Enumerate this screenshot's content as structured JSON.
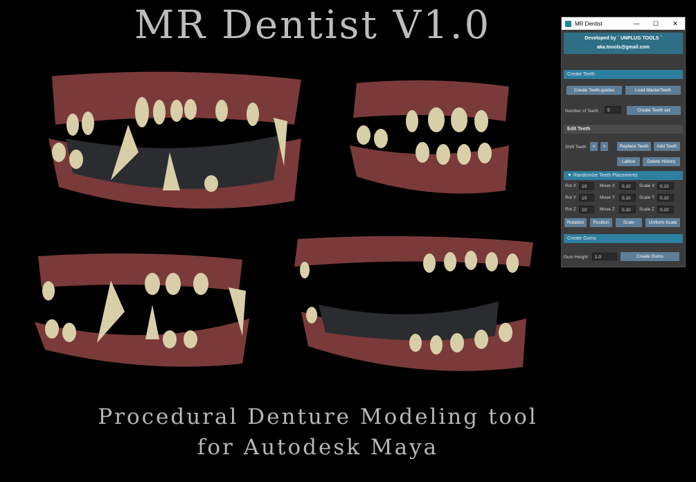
{
  "poster": {
    "title": "MR Dentist V1.0",
    "subtitle_line1": "Procedural Denture Modeling tool",
    "subtitle_line2": "for Autodesk Maya"
  },
  "window": {
    "title": "MR Dentist",
    "controls": {
      "minimize": "—",
      "maximize": "☐",
      "close": "✕"
    },
    "banner": {
      "line1": "Developed by ` UNPLUG TOOLS `",
      "line2": "aka.toools@gmail.com"
    },
    "create_teeth": {
      "header": "Create Teeth",
      "create_guides": "Create Teeth-guides",
      "load_master": "Load MasterTeeth",
      "number_label": "Number of Teeth",
      "number_value": "5",
      "create_set": "Create Teeth set"
    },
    "edit_teeth": {
      "header": "Edit Teeth",
      "shift_label": "Shift Teeth",
      "shift_left": "<",
      "shift_right": ">",
      "replace": "Replace Teeth",
      "add": "Add Teeth",
      "lattice": "Lattice",
      "delete_history": "Delete History"
    },
    "randomize": {
      "header": "Randomize Teeth Placements",
      "rows": [
        {
          "rot_label": "Rot X",
          "rot": "10",
          "move_label": "Move X",
          "move": "0.10",
          "scale_label": "Scale X",
          "scale": "0.10"
        },
        {
          "rot_label": "Rot Y",
          "rot": "10",
          "move_label": "Move Y",
          "move": "0.10",
          "scale_label": "Scale Y",
          "scale": "0.10"
        },
        {
          "rot_label": "Rot Z",
          "rot": "10",
          "move_label": "Move Z",
          "move": "0.10",
          "scale_label": "Scale Z",
          "scale": "0.10"
        }
      ],
      "rotation": "Rotation",
      "position": "Position",
      "scale": "Scale",
      "uniform": "Uniform Scale"
    },
    "create_gums": {
      "header": "Create Gums",
      "height_label": "Gum Height",
      "height_value": "1.0",
      "button": "Create Gums"
    }
  },
  "colors": {
    "accent": "#2d7fa0",
    "button": "#5e7d96",
    "panel": "#3b3b3b"
  }
}
